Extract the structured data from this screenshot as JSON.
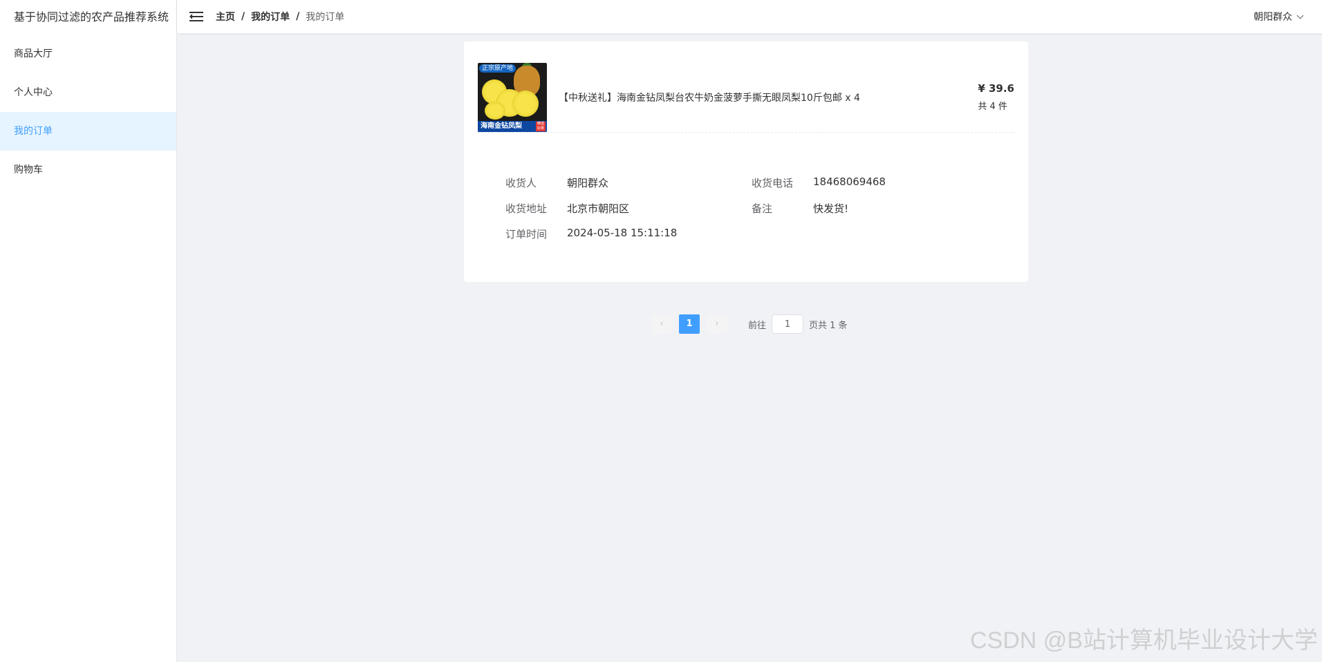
{
  "sidebar": {
    "brand": "基于协同过滤的农产品推荐系统",
    "items": [
      {
        "label": "商品大厅"
      },
      {
        "label": "个人中心"
      },
      {
        "label": "我的订单"
      },
      {
        "label": "购物车"
      }
    ]
  },
  "header": {
    "breadcrumb": [
      "主页",
      "我的订单",
      "我的订单"
    ],
    "separator": "/",
    "user": "朝阳群众"
  },
  "order": {
    "image_tag_top": "正宗原产地",
    "image_tag_bottom": "海南金钻凤梨",
    "image_badge": "精选好果",
    "product_title": "【中秋送礼】海南金钻凤梨台农牛奶金菠萝手撕无眼凤梨10斤包邮 x 4",
    "price": "¥ 39.6",
    "quantity": "共 4 件",
    "fields": {
      "receiver_label": "收货人",
      "receiver": "朝阳群众",
      "phone_label": "收货电话",
      "phone": "18468069468",
      "address_label": "收货地址",
      "address": "北京市朝阳区",
      "note_label": "备注",
      "note": "快发货!",
      "time_label": "订单时间",
      "time": "2024-05-18 15:11:18"
    }
  },
  "pagination": {
    "prev": "‹",
    "next": "›",
    "current_page": "1",
    "goto_label": "前往",
    "goto_value": "1",
    "total_text": "页共 1 条"
  },
  "watermark": "CSDN @B站计算机毕业设计大学"
}
